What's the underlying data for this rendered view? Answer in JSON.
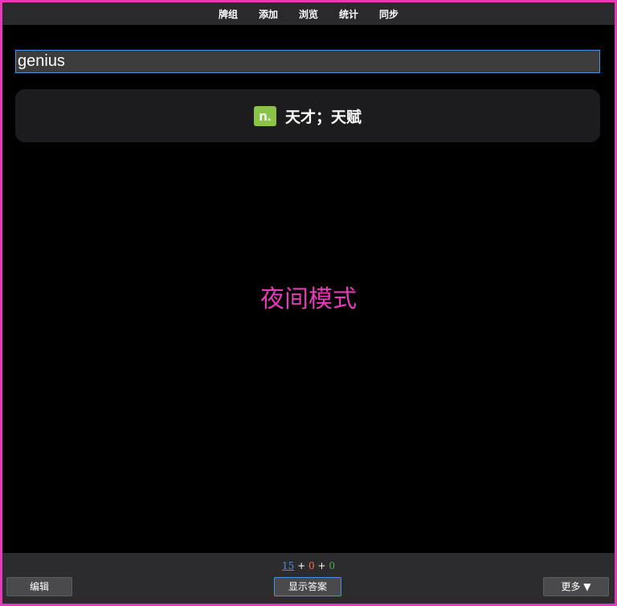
{
  "nav": {
    "items": [
      {
        "label": "牌组"
      },
      {
        "label": "添加"
      },
      {
        "label": "浏览"
      },
      {
        "label": "统计"
      },
      {
        "label": "同步"
      }
    ]
  },
  "card": {
    "answer_input_value": "genius",
    "pos": "n.",
    "meaning": "天才；天赋",
    "mode_text": "夜间模式"
  },
  "bottom": {
    "counts": {
      "new": "15",
      "learn": "0",
      "review": "0",
      "separator": "+"
    },
    "edit_label": "编辑",
    "show_answer_label": "显示答案",
    "more_label": "更多 ▼"
  },
  "colors": {
    "frame_border": "#e43cb8",
    "pos_badge": "#8bc34a",
    "count_new": "#4a90e2",
    "count_learn": "#ff6b4a",
    "count_review": "#4caf50"
  }
}
